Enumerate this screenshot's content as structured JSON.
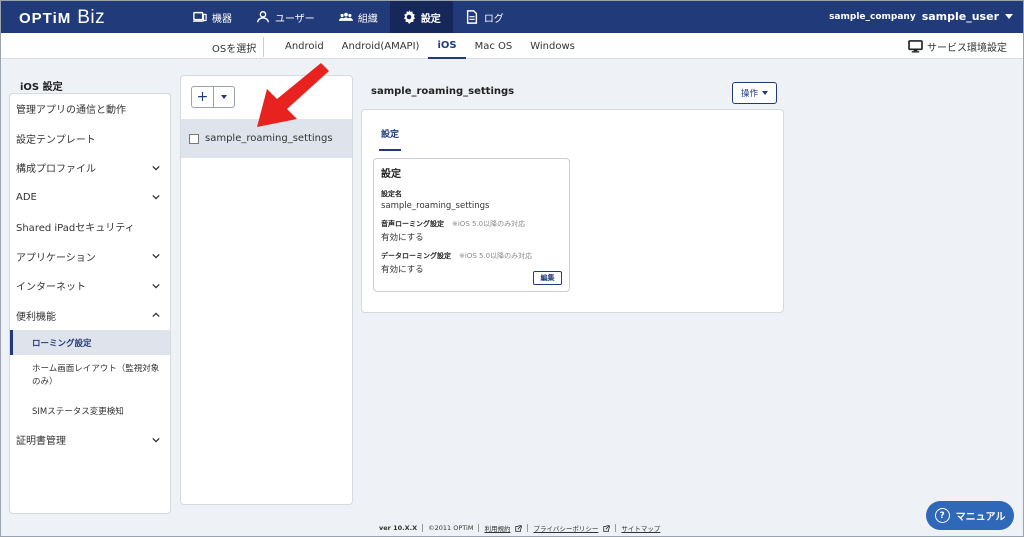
{
  "header": {
    "logo_optim": "OPTiM",
    "logo_biz": "Biz",
    "nav": [
      {
        "label": "機器",
        "icon": "device-icon"
      },
      {
        "label": "ユーザー",
        "icon": "user-icon"
      },
      {
        "label": "組織",
        "icon": "group-icon"
      },
      {
        "label": "設定",
        "icon": "gear-icon",
        "active": true
      },
      {
        "label": "ログ",
        "icon": "document-icon"
      }
    ],
    "company": "sample_company",
    "user": "sample_user"
  },
  "osbar": {
    "select_label": "OSを選択",
    "tabs": [
      "Android",
      "Android(AMAPI)",
      "iOS",
      "Mac OS",
      "Windows"
    ],
    "active_tab": "iOS",
    "service_env": "サービス環境設定"
  },
  "sidebar": {
    "title": "iOS 設定",
    "items": [
      {
        "label": "管理アプリの通信と動作",
        "chevron": ""
      },
      {
        "label": "設定テンプレート",
        "chevron": ""
      },
      {
        "label": "構成プロファイル",
        "chevron": "down"
      },
      {
        "label": "ADE",
        "chevron": "down"
      },
      {
        "label": "Shared iPadセキュリティ",
        "chevron": ""
      },
      {
        "label": "アプリケーション",
        "chevron": "down"
      },
      {
        "label": "インターネット",
        "chevron": "down"
      },
      {
        "label": "便利機能",
        "chevron": "up"
      }
    ],
    "subitems": [
      {
        "label": "ローミング設定",
        "active": true
      },
      {
        "label": "ホーム画面レイアウト（監視対象のみ）",
        "active": false
      },
      {
        "label": "SIMステータス変更検知",
        "active": false
      }
    ],
    "last_item": {
      "label": "証明書管理",
      "chevron": "down"
    }
  },
  "list": {
    "add_label": "+",
    "items": [
      "sample_roaming_settings"
    ]
  },
  "detail": {
    "title": "sample_roaming_settings",
    "ops_label": "操作",
    "tab": "設定",
    "card": {
      "title": "設定",
      "fields": [
        {
          "label": "設定名",
          "note": "",
          "value": "sample_roaming_settings"
        },
        {
          "label": "音声ローミング設定",
          "note": "※iOS 5.0以降のみ対応",
          "value": "有効にする"
        },
        {
          "label": "データローミング設定",
          "note": "※iOS 5.0以降のみ対応",
          "value": "有効にする"
        }
      ],
      "edit_label": "編集"
    }
  },
  "footer": {
    "version": "ver 10.X.X",
    "copyright": "©2011 OPTiM",
    "terms": "利用規約",
    "privacy": "プライバシーポリシー",
    "sitemap": "サイトマップ"
  },
  "manual_label": "マニュアル",
  "colors": {
    "brand": "#213a7a",
    "accent": "#2f67b9",
    "arrow": "#e8231f"
  }
}
